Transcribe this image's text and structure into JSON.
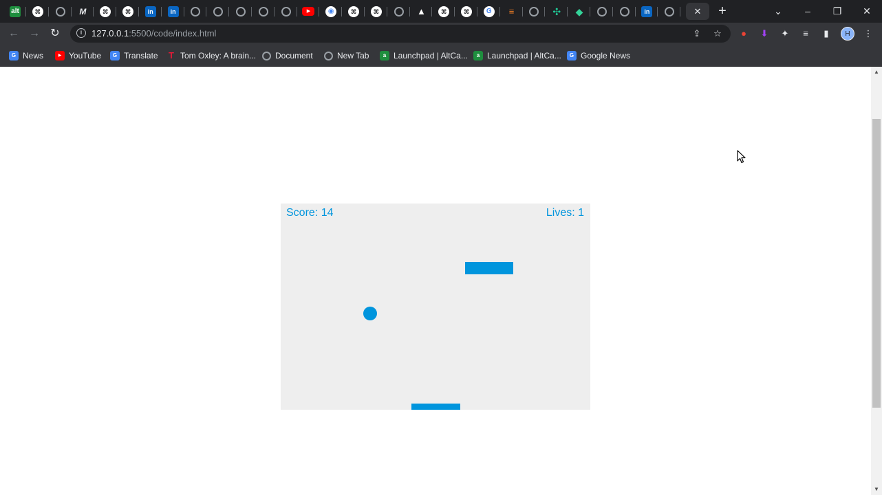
{
  "browser": {
    "url_host": "127.0.0.1",
    "url_path": ":5500/code/index.html",
    "avatar_initial": "H",
    "new_tab_glyph": "+",
    "tab_close_glyph": "✕"
  },
  "tabs": [
    {
      "icon": "altcampus-icon",
      "glyph": "alt"
    },
    {
      "icon": "github-icon",
      "glyph": "⌘"
    },
    {
      "icon": "globe-icon",
      "glyph": ""
    },
    {
      "icon": "medium-icon",
      "glyph": "M"
    },
    {
      "icon": "github-icon",
      "glyph": "⌘"
    },
    {
      "icon": "github-icon",
      "glyph": "⌘"
    },
    {
      "icon": "linkedin-icon",
      "glyph": "in"
    },
    {
      "icon": "linkedin-icon",
      "glyph": "in"
    },
    {
      "icon": "globe-icon",
      "glyph": ""
    },
    {
      "icon": "globe-icon",
      "glyph": ""
    },
    {
      "icon": "globe-icon",
      "glyph": ""
    },
    {
      "icon": "globe-icon",
      "glyph": ""
    },
    {
      "icon": "globe-icon",
      "glyph": ""
    },
    {
      "icon": "youtube-icon",
      "glyph": "▶"
    },
    {
      "icon": "chrome-icon",
      "glyph": "◉"
    },
    {
      "icon": "github-icon",
      "glyph": "⌘"
    },
    {
      "icon": "github-icon",
      "glyph": "⌘"
    },
    {
      "icon": "globe-icon",
      "glyph": ""
    },
    {
      "icon": "triangle-icon",
      "glyph": "▲"
    },
    {
      "icon": "github-icon",
      "glyph": "⌘"
    },
    {
      "icon": "github-icon",
      "glyph": "⌘"
    },
    {
      "icon": "google-icon",
      "glyph": "G"
    },
    {
      "icon": "stackoverflow-icon",
      "glyph": "≡"
    },
    {
      "icon": "globe-icon",
      "glyph": ""
    },
    {
      "icon": "dots-icon",
      "glyph": "✣"
    },
    {
      "icon": "gem-icon",
      "glyph": "◆"
    },
    {
      "icon": "globe-icon",
      "glyph": ""
    },
    {
      "icon": "globe-icon",
      "glyph": ""
    },
    {
      "icon": "linkedin-icon",
      "glyph": "in"
    },
    {
      "icon": "globe-icon",
      "glyph": ""
    }
  ],
  "bookmarks": [
    {
      "label": "News",
      "icon": "google-news-icon"
    },
    {
      "label": "YouTube",
      "icon": "youtube-icon"
    },
    {
      "label": "Translate",
      "icon": "translate-icon"
    },
    {
      "label": "Tom Oxley: A brain...",
      "icon": "tesla-icon"
    },
    {
      "label": "Document",
      "icon": "globe-icon"
    },
    {
      "label": "New Tab",
      "icon": "globe-icon"
    },
    {
      "label": "Launchpad | AltCa...",
      "icon": "altcampus-icon"
    },
    {
      "label": "Launchpad | AltCa...",
      "icon": "altcampus-icon"
    },
    {
      "label": "Google News",
      "icon": "google-news-icon"
    }
  ],
  "game": {
    "score_text": "Score: 14",
    "lives_text": "Lives: 1",
    "score": 14,
    "lives": 1,
    "color": "#0095dd",
    "background": "#eeeeee"
  }
}
